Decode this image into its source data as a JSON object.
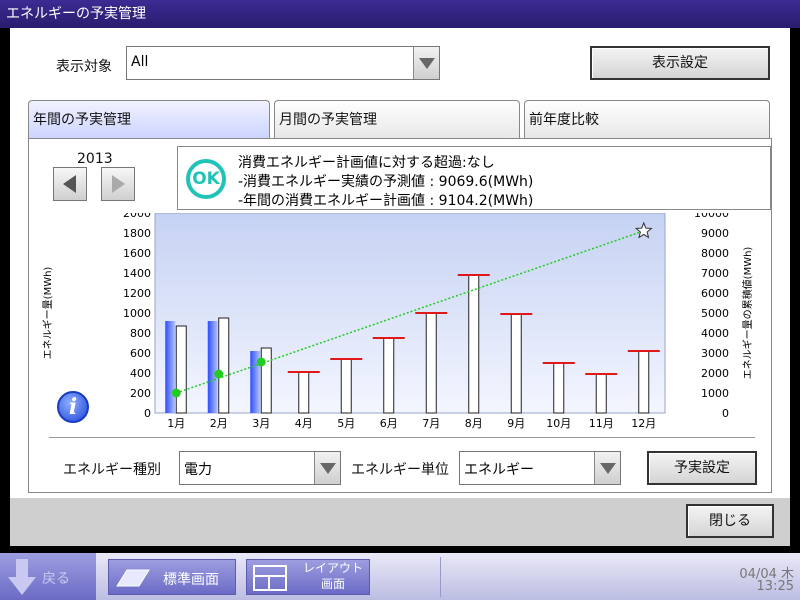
{
  "window": {
    "title": "エネルギーの予実管理"
  },
  "display_target": {
    "label": "表示対象",
    "value": "All"
  },
  "display_settings_button": "表示設定",
  "tabs": [
    {
      "label": "年間の予実管理",
      "active": true
    },
    {
      "label": "月間の予実管理",
      "active": false
    },
    {
      "label": "前年度比較",
      "active": false
    }
  ],
  "year": "2013",
  "status": {
    "ok_label": "OK",
    "line1": "消費エネルギー計画値に対する超過:なし",
    "line2": "-消費エネルギー実績の予測値 : 9069.6(MWh)",
    "line3": "-年間の消費エネルギー計画値 : 9104.2(MWh)"
  },
  "energy_type": {
    "label": "エネルギー種別",
    "value": "電力"
  },
  "energy_unit": {
    "label": "エネルギー単位",
    "value": "エネルギー"
  },
  "budget_button": "予実設定",
  "close_button": "閉じる",
  "taskbar": {
    "back": "戻る",
    "standard": "標準画面",
    "layout_line1": "レイアウト",
    "layout_line2": "画面",
    "date": "04/04 木",
    "time": "13:25"
  },
  "colors": {
    "actual": "#3b5bff",
    "plan_marker": "#e01818",
    "cumulative": "#22cc22"
  },
  "chart_data": {
    "type": "bar",
    "categories": [
      "1月",
      "2月",
      "3月",
      "4月",
      "5月",
      "6月",
      "7月",
      "8月",
      "9月",
      "10月",
      "11月",
      "12月"
    ],
    "ylabel": "エネルギー量(MWh)",
    "y2label": "エネルギー量の累積値(MWh)",
    "ylim": [
      0,
      2000
    ],
    "y2lim": [
      0,
      10000
    ],
    "yticks": [
      "0",
      "200",
      "400",
      "600",
      "800",
      "1000",
      "1200",
      "1400",
      "1600",
      "1800",
      "2000"
    ],
    "y2ticks": [
      "0",
      "1000",
      "2000",
      "3000",
      "4000",
      "5000",
      "6000",
      "7000",
      "8000",
      "9000",
      "10000"
    ],
    "series": [
      {
        "role": "actual",
        "values": [
          920,
          920,
          620,
          null,
          null,
          null,
          null,
          null,
          null,
          null,
          null,
          null
        ]
      },
      {
        "role": "plan",
        "values": [
          870,
          950,
          650,
          410,
          540,
          750,
          1000,
          1380,
          990,
          500,
          390,
          620
        ]
      },
      {
        "role": "cumulative",
        "axis": "right",
        "values": [
          1000,
          1950,
          2550,
          null,
          null,
          null,
          null,
          null,
          null,
          null,
          null,
          9104.2
        ]
      }
    ]
  }
}
